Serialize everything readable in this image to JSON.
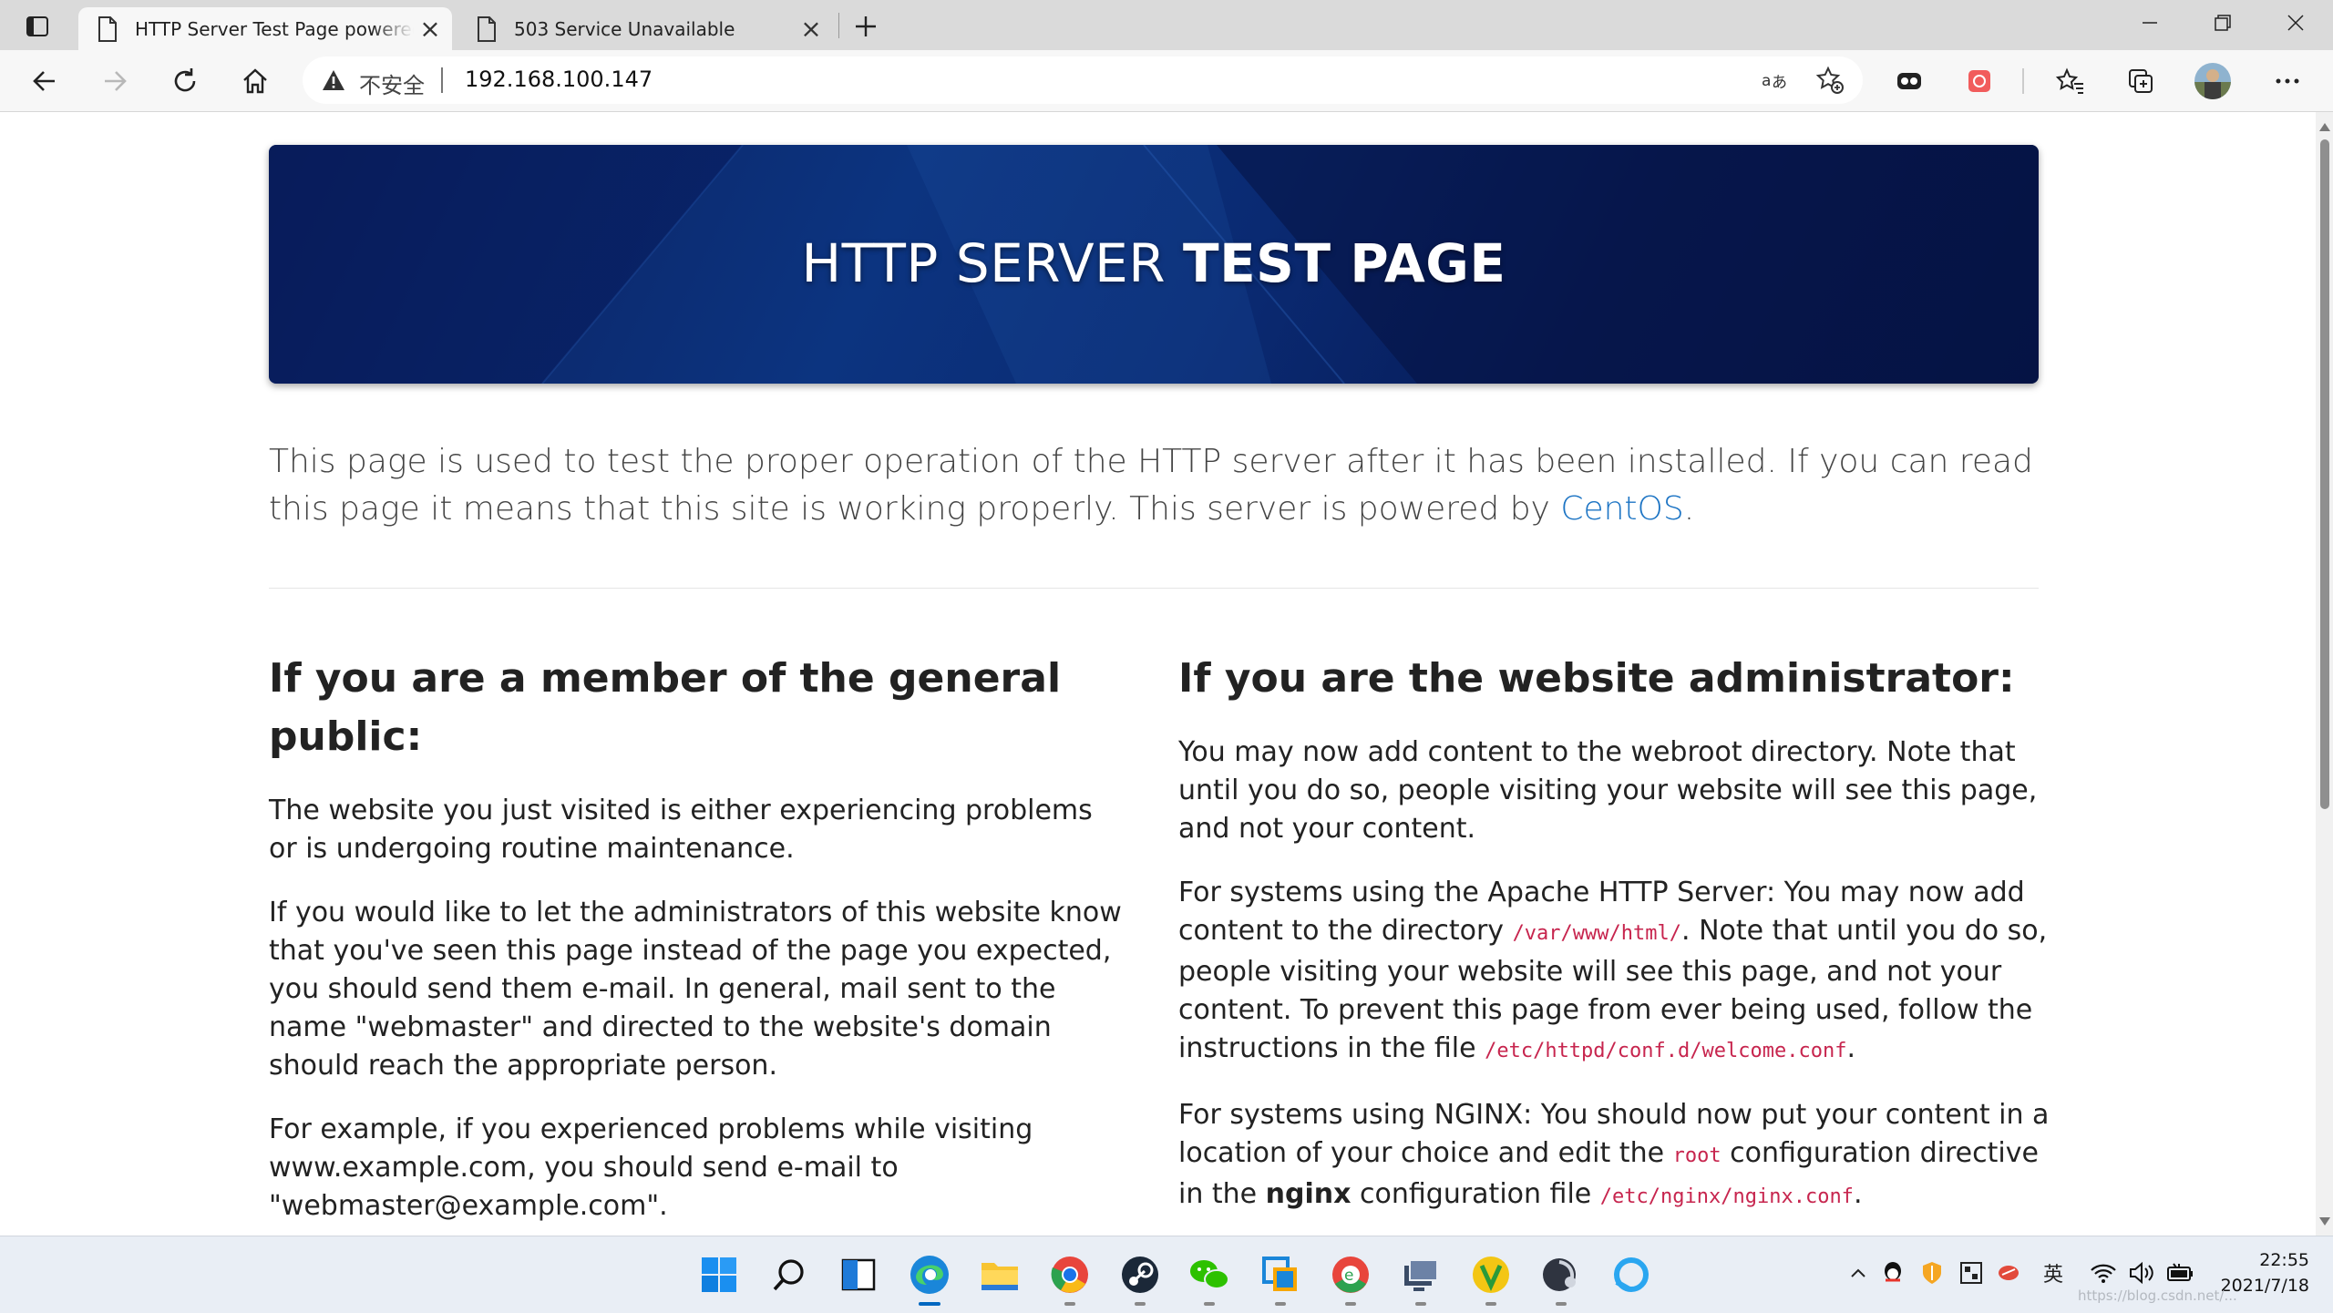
{
  "browser": {
    "tabs": [
      {
        "title": "HTTP Server Test Page powered by CentOS",
        "active": true
      },
      {
        "title": "503 Service Unavailable",
        "active": false
      }
    ],
    "new_tab_label": "+",
    "address": {
      "security_label": "不安全",
      "url": "192.168.100.147"
    }
  },
  "page": {
    "banner": {
      "title_light": "HTTP SERVER",
      "title_bold": "TEST PAGE"
    },
    "intro": {
      "text": "This page is used to test the proper operation of the HTTP server after it has been installed. If you can read this page it means that this site is working properly. This server is powered by ",
      "link": "CentOS",
      "tail": "."
    },
    "public": {
      "heading": "If you are a member of the general public:",
      "p1": "The website you just visited is either experiencing problems or is undergoing routine maintenance.",
      "p2": "If you would like to let the administrators of this website know that you've seen this page instead of the page you expected, you should send them e-mail. In general, mail sent to the name \"webmaster\" and directed to the website's domain should reach the appropriate person.",
      "p3": "For example, if you experienced problems while visiting www.example.com, you should send e-mail to \"webmaster@example.com\"."
    },
    "admin": {
      "heading": "If you are the website administrator:",
      "p1": "You may now add content to the webroot directory. Note that until you do so, people visiting your website will see this page, and not your content.",
      "p2_a": "For systems using the Apache HTTP Server: You may now add content to the directory ",
      "p2_code1": "/var/www/html/",
      "p2_b": ". Note that until you do so, people visiting your website will see this page, and not your content. To prevent this page from ever being used, follow the instructions in the file ",
      "p2_code2": "/etc/httpd/conf.d/welcome.conf",
      "p2_c": ".",
      "p3_a": "For systems using NGINX: You should now put your content in a location of your choice and edit the ",
      "p3_code1": "root",
      "p3_b": " configuration directive in the ",
      "p3_strong": "nginx",
      "p3_c": " configuration file ",
      "p3_code2": "/etc/nginx/nginx.conf",
      "p3_d": "."
    }
  },
  "taskbar": {
    "ime": "英",
    "time": "22:55",
    "date": "2021/7/18",
    "watermark": "https://blog.csdn.net/..."
  },
  "colors": {
    "link": "#1c74c4",
    "code": "#c7254e",
    "banner": "#0b2a74"
  }
}
